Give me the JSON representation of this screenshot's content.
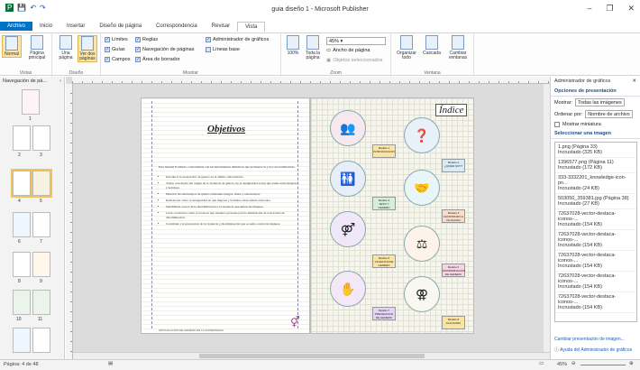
{
  "window": {
    "title": "guia diseño 1 - Microsoft Publisher",
    "minimize": "–",
    "restore": "❐",
    "close": "✕"
  },
  "qat": {
    "save_icon": "save-icon",
    "undo_icon": "undo-icon",
    "redo_icon": "redo-icon"
  },
  "tabs": [
    {
      "label": "Archivo"
    },
    {
      "label": "Inicio"
    },
    {
      "label": "Insertar"
    },
    {
      "label": "Diseño de página"
    },
    {
      "label": "Correspondencia"
    },
    {
      "label": "Revisar"
    },
    {
      "label": "Vista"
    }
  ],
  "ribbon": {
    "vistas": {
      "normal": "Normal",
      "pagina_principal": "Página principal",
      "label": "Vistas"
    },
    "diseno": {
      "una_pagina": "Una página",
      "ver_dos": "Ver dos páginas",
      "label": "Diseño"
    },
    "mostrar": {
      "limites": "Límites",
      "guias": "Guías",
      "campos": "Campos",
      "reglas": "Reglas",
      "navegacion": "Navegación de páginas",
      "area_borrador": "Área de borrador",
      "admin_graficos": "Administrador de gráficos",
      "lineas_base": "Líneas base",
      "label": "Mostrar"
    },
    "zoom": {
      "cien": "100%",
      "toda_pagina": "Toda la página",
      "value": "45%",
      "ancho_pagina": "Ancho de página",
      "objetos_sel": "Objetos seleccionados",
      "label": "Zoom"
    },
    "ventana": {
      "organizar": "Organizar todo",
      "cascada": "Cascada",
      "cambiar": "Cambiar ventanas",
      "label": "Ventana"
    }
  },
  "nav": {
    "title": "Navegación de pá...",
    "pages": [
      {
        "num": "1"
      },
      {
        "num": "2"
      },
      {
        "num": "3"
      },
      {
        "num": "4"
      },
      {
        "num": "5"
      },
      {
        "num": "6"
      },
      {
        "num": "7"
      },
      {
        "num": "8"
      },
      {
        "num": "9"
      },
      {
        "num": "10"
      },
      {
        "num": "11"
      }
    ]
  },
  "document": {
    "title": "Objetivos",
    "intro": "Esta manual Formado, concerniente con las herramientas didácticas que promueve la y los/ las facilitadores.",
    "bullets": [
      "Introducir la perspectiva de género en el ámbito universitario.",
      "Tomar conciencia del origen de la violencia de género, de la desigualdad social que existe entre mujeres y hombres.",
      "Detectar las estereotipos de género existentes riesgos, mitos y estereotipos.",
      "Reflexionar sobre la desigualdad en que mujeres y hombres están siendo educados.",
      "Sensibilizar acerca de la discriminación y la violencia que sufren las mujeres.",
      "Crear conciencia sobre el recursos que tenemos personas para la eliminación de toda forma de discriminación.",
      "Contribuir a la prevención de la violencia y discriminación que se sufre contra las mujeres."
    ],
    "footer": "ARTICULACION DE GENERO EN LA UNIVERSIDAD",
    "indice": "Índice",
    "modules": [
      {
        "title": "Modulo 1",
        "sub": "INTRODUCCION"
      },
      {
        "title": "Modulo 2",
        "sub": "¿QUIEN SOY?"
      },
      {
        "title": "Modulo 3",
        "sub": "SEXO Y GENERO"
      },
      {
        "title": "Modulo 4",
        "sub": "CONSTRUIR LA IGUALDAD"
      },
      {
        "title": "Modulo 5",
        "sub": "VIOLENCIA DE GENERO"
      },
      {
        "title": "Modulo 6",
        "sub": "DISCRIMINACION DE GENERO"
      },
      {
        "title": "Modulo 7",
        "sub": "PREVENCION DE GENERO"
      },
      {
        "title": "Modulo 8",
        "sub": "CLAUSURA"
      }
    ]
  },
  "graphics_manager": {
    "title": "Administrador de gráficos",
    "section_opts": "Opciones de presentación",
    "mostrar_label": "Mostrar:",
    "mostrar_value": "Todas las imágenes",
    "ordenar_label": "Ordenar por:",
    "ordenar_value": "Nombre de archivo",
    "miniatura": "Mostrar miniatura",
    "section_sel": "Seleccionar una imagen",
    "images": [
      {
        "name": "1.png (Página 33)",
        "status": "Incrustado (325 KB)"
      },
      {
        "name": "1396577.png (Página 11)",
        "status": "Incrustado (172 KB)"
      },
      {
        "name": "333-3332201_knowledge-icon-pn...",
        "status": "Incrustado (24 KB)"
      },
      {
        "name": "503050_359381.jpg (Página 38)",
        "status": "Incrustado (27 KB)"
      },
      {
        "name": "72637028-vector-destaca-iconos-...",
        "status": "Incrustado (154 KB)"
      },
      {
        "name": "72637028-vector-destaca-iconos-...",
        "status": "Incrustado (154 KB)"
      },
      {
        "name": "72637028-vector-destaca-iconos-...",
        "status": "Incrustado (154 KB)"
      },
      {
        "name": "72637028-vector-destaca-iconos-...",
        "status": "Incrustado (154 KB)"
      },
      {
        "name": "72637028-vector-destaca-iconos-...",
        "status": "Incrustado (154 KB)"
      }
    ],
    "link_change": "Cambiar presentación de imagen...",
    "link_help": "Ayuda del Administrador de gráficos"
  },
  "status": {
    "page": "Página: 4 de 48",
    "zoom": "45%"
  }
}
